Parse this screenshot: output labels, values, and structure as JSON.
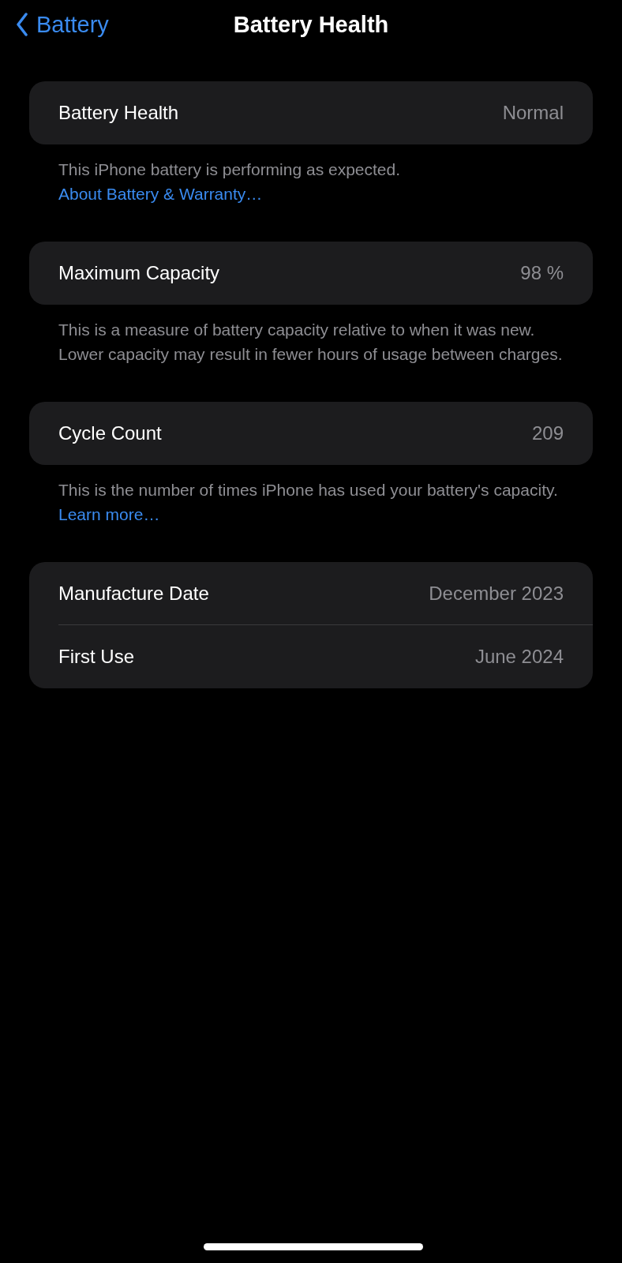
{
  "nav": {
    "back_label": "Battery",
    "title": "Battery Health"
  },
  "sections": [
    {
      "rows": [
        {
          "label": "Battery Health",
          "value": "Normal"
        }
      ],
      "footer": "This iPhone battery is performing as expected. ",
      "footer_link": "About Battery & Warranty…"
    },
    {
      "rows": [
        {
          "label": "Maximum Capacity",
          "value": "98 %"
        }
      ],
      "footer": "This is a measure of battery capacity relative to when it was new. Lower capacity may result in fewer hours of usage between charges."
    },
    {
      "rows": [
        {
          "label": "Cycle Count",
          "value": "209"
        }
      ],
      "footer": "This is the number of times iPhone has used your battery's capacity. ",
      "footer_link": "Learn more…"
    },
    {
      "rows": [
        {
          "label": "Manufacture Date",
          "value": "December 2023"
        },
        {
          "label": "First Use",
          "value": "June 2024"
        }
      ]
    }
  ]
}
